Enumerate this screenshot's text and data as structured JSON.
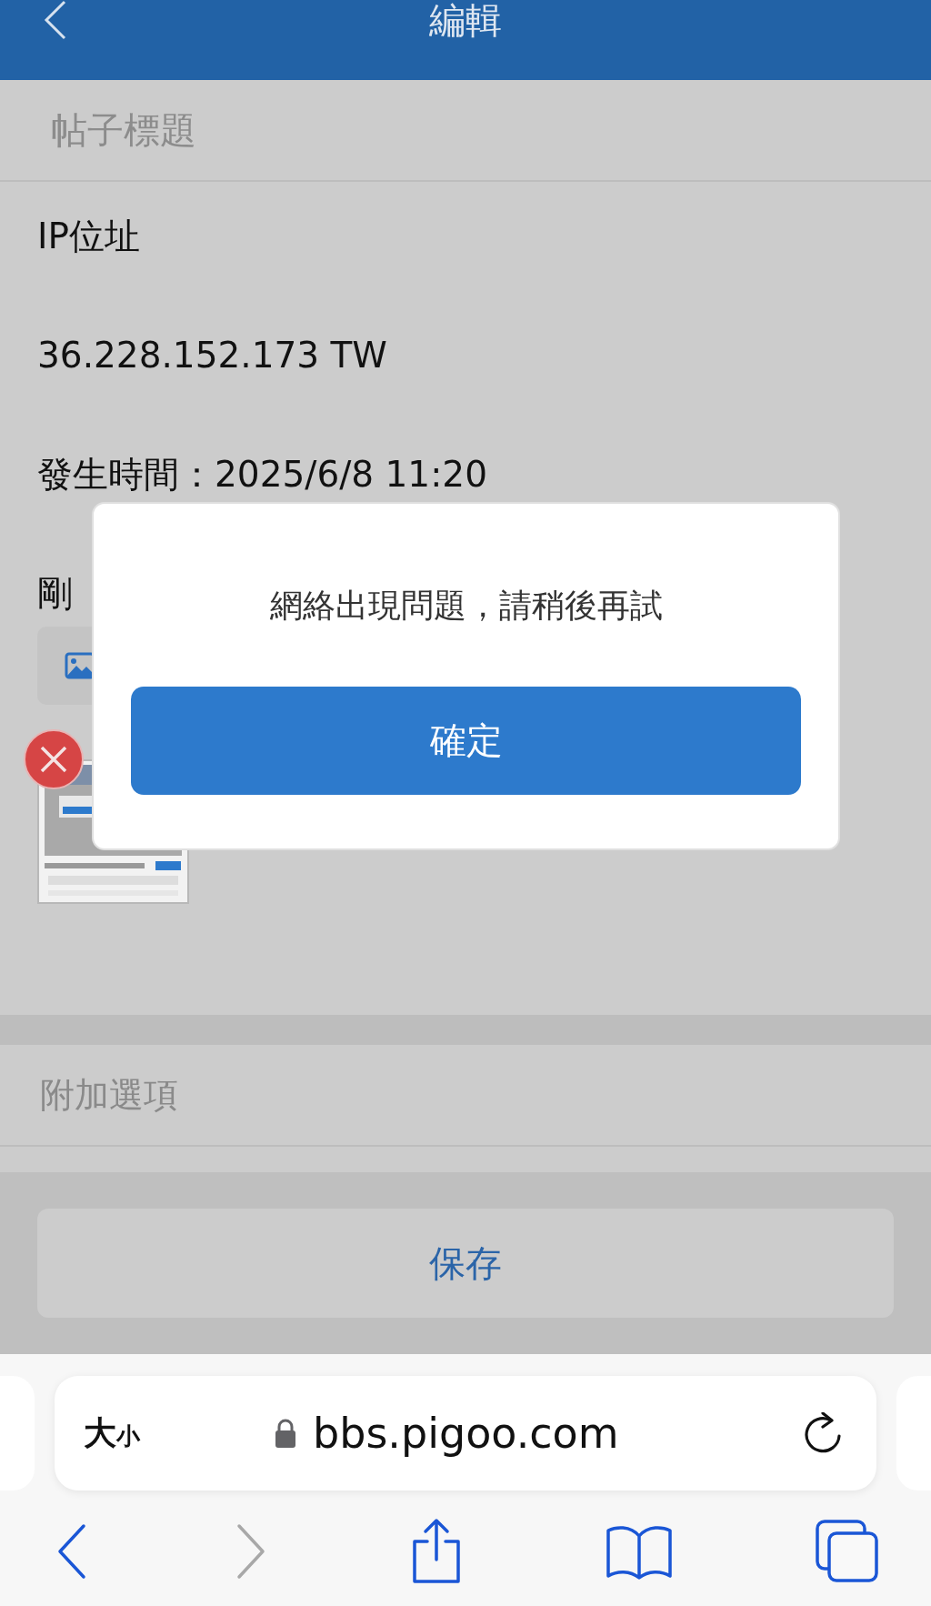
{
  "header": {
    "title": "編輯"
  },
  "title_field": {
    "placeholder": "帖子標題"
  },
  "content_lines": [
    "IP位址",
    "36.228.152.173 TW",
    "發生時間：2025/6/8 11:20",
    "剛"
  ],
  "attachments": [
    {
      "kind": "picture"
    }
  ],
  "options_row": {
    "label": "附加選項"
  },
  "save_button": {
    "label": "保存"
  },
  "browser": {
    "text_size": {
      "large": "大",
      "small": "小"
    },
    "url": "bbs.pigoo.com"
  },
  "nav_buttons": [
    {
      "kind": "back",
      "disabled": false
    },
    {
      "kind": "forward",
      "disabled": true
    },
    {
      "kind": "share",
      "disabled": false
    },
    {
      "kind": "bookmarks",
      "disabled": false
    },
    {
      "kind": "tabs",
      "disabled": false
    }
  ],
  "dialog": {
    "message": "網絡出現問題，請稍後再試",
    "button": "確定"
  }
}
